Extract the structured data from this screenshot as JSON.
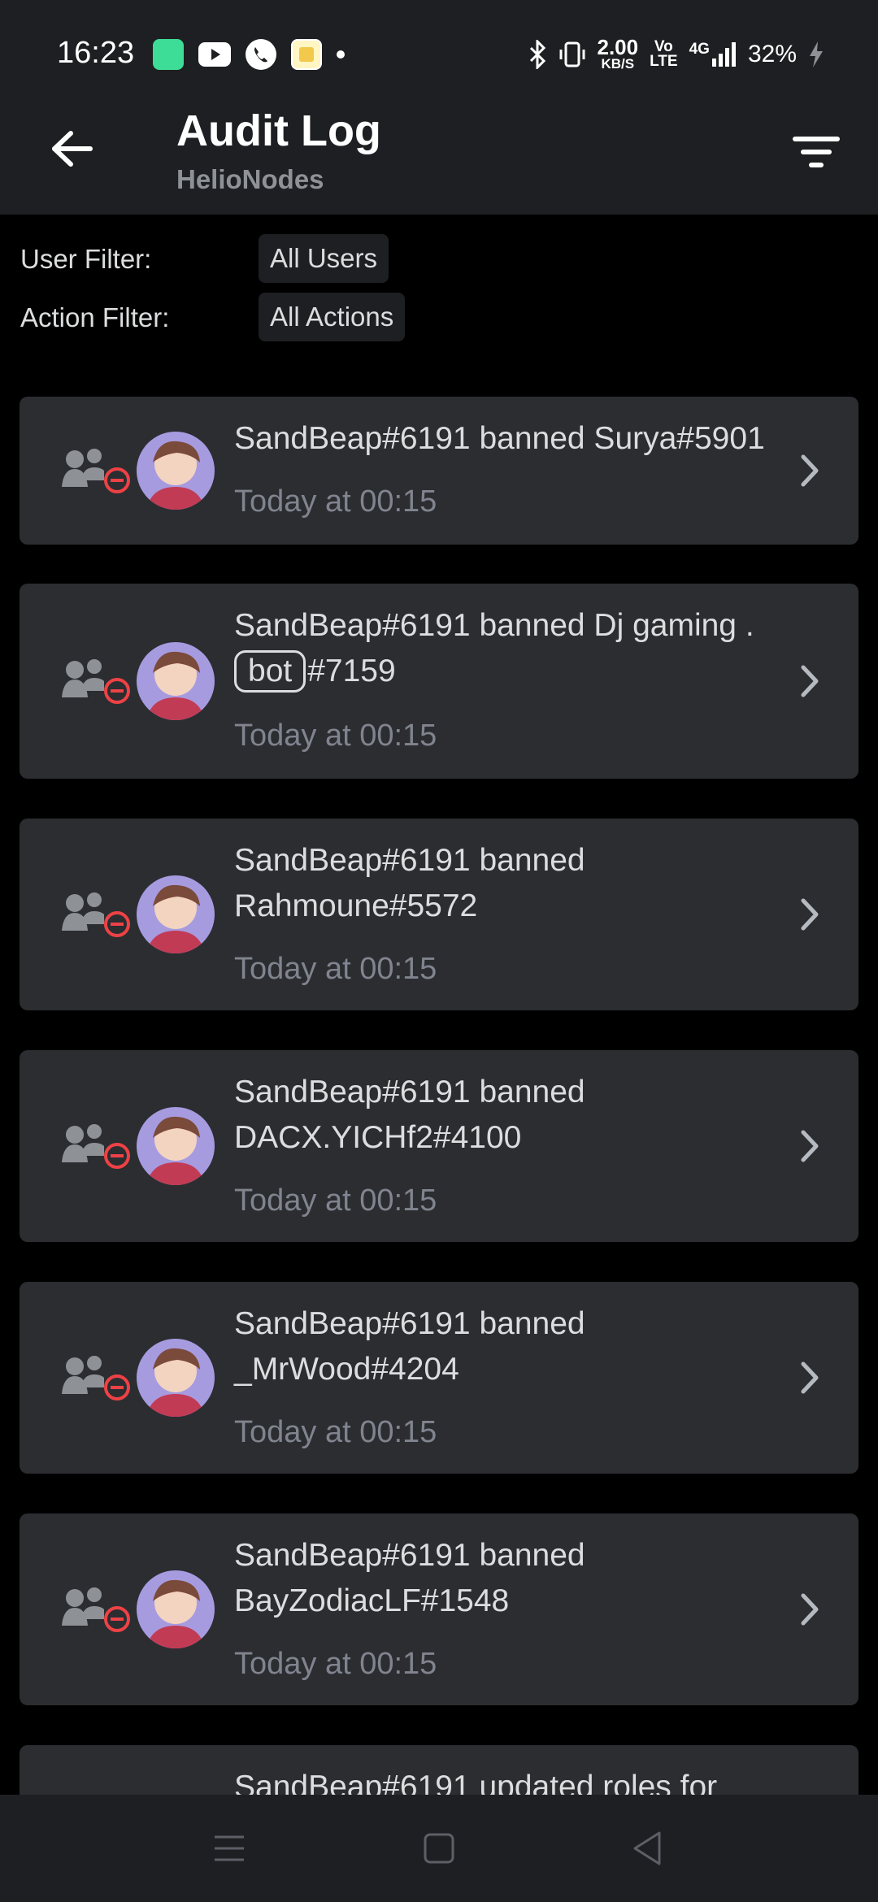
{
  "status_bar": {
    "time": "16:23",
    "net_speed_value": "2.00",
    "net_speed_unit": "KB/S",
    "volte_top": "Vo",
    "volte_bottom": "LTE",
    "network": "4G",
    "battery": "32%"
  },
  "header": {
    "title": "Audit Log",
    "subtitle": "HelioNodes"
  },
  "filters": {
    "user_label": "User Filter:",
    "user_value": "All Users",
    "action_label": "Action Filter:",
    "action_value": "All Actions"
  },
  "entries": [
    {
      "text": "SandBeap#6191 banned Surya#5901",
      "time": "Today at 00:15"
    },
    {
      "text_before": "SandBeap#6191 banned Dj gaming .",
      "badge": "bot",
      "text_after": "#7159",
      "time": "Today at 00:15"
    },
    {
      "text": "SandBeap#6191 banned Rahmoune#5572",
      "time": "Today at 00:15"
    },
    {
      "text": "SandBeap#6191 banned DACX.YICHf2#4100",
      "time": "Today at 00:15"
    },
    {
      "text": "SandBeap#6191 banned _MrWood#4204",
      "time": "Today at 00:15"
    },
    {
      "text": "SandBeap#6191 banned BayZodiacLF#1548",
      "time": "Today at 00:15"
    },
    {
      "text": "SandBeap#6191 updated roles for",
      "time": ""
    }
  ],
  "colors": {
    "background": "#000000",
    "card": "#2b2d31",
    "header": "#1e1f22",
    "ban_icon_red": "#ed4245",
    "muted_text": "#80848e"
  }
}
